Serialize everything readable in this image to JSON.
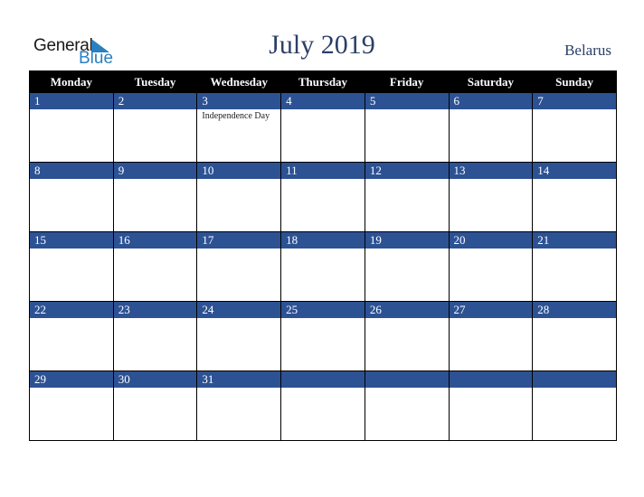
{
  "brand": {
    "line1": "General",
    "line2": "Blue",
    "accent": "#2a7fc1"
  },
  "title": "July 2019",
  "country": "Belarus",
  "colors": {
    "header_bg": "#000000",
    "day_bar": "#2d5294",
    "title": "#2b3f68"
  },
  "weekdays": [
    "Monday",
    "Tuesday",
    "Wednesday",
    "Thursday",
    "Friday",
    "Saturday",
    "Sunday"
  ],
  "weeks": [
    [
      {
        "day": "1",
        "event": ""
      },
      {
        "day": "2",
        "event": ""
      },
      {
        "day": "3",
        "event": "Independence Day"
      },
      {
        "day": "4",
        "event": ""
      },
      {
        "day": "5",
        "event": ""
      },
      {
        "day": "6",
        "event": ""
      },
      {
        "day": "7",
        "event": ""
      }
    ],
    [
      {
        "day": "8",
        "event": ""
      },
      {
        "day": "9",
        "event": ""
      },
      {
        "day": "10",
        "event": ""
      },
      {
        "day": "11",
        "event": ""
      },
      {
        "day": "12",
        "event": ""
      },
      {
        "day": "13",
        "event": ""
      },
      {
        "day": "14",
        "event": ""
      }
    ],
    [
      {
        "day": "15",
        "event": ""
      },
      {
        "day": "16",
        "event": ""
      },
      {
        "day": "17",
        "event": ""
      },
      {
        "day": "18",
        "event": ""
      },
      {
        "day": "19",
        "event": ""
      },
      {
        "day": "20",
        "event": ""
      },
      {
        "day": "21",
        "event": ""
      }
    ],
    [
      {
        "day": "22",
        "event": ""
      },
      {
        "day": "23",
        "event": ""
      },
      {
        "day": "24",
        "event": ""
      },
      {
        "day": "25",
        "event": ""
      },
      {
        "day": "26",
        "event": ""
      },
      {
        "day": "27",
        "event": ""
      },
      {
        "day": "28",
        "event": ""
      }
    ],
    [
      {
        "day": "29",
        "event": ""
      },
      {
        "day": "30",
        "event": ""
      },
      {
        "day": "31",
        "event": ""
      },
      {
        "day": "",
        "event": ""
      },
      {
        "day": "",
        "event": ""
      },
      {
        "day": "",
        "event": ""
      },
      {
        "day": "",
        "event": ""
      }
    ]
  ]
}
